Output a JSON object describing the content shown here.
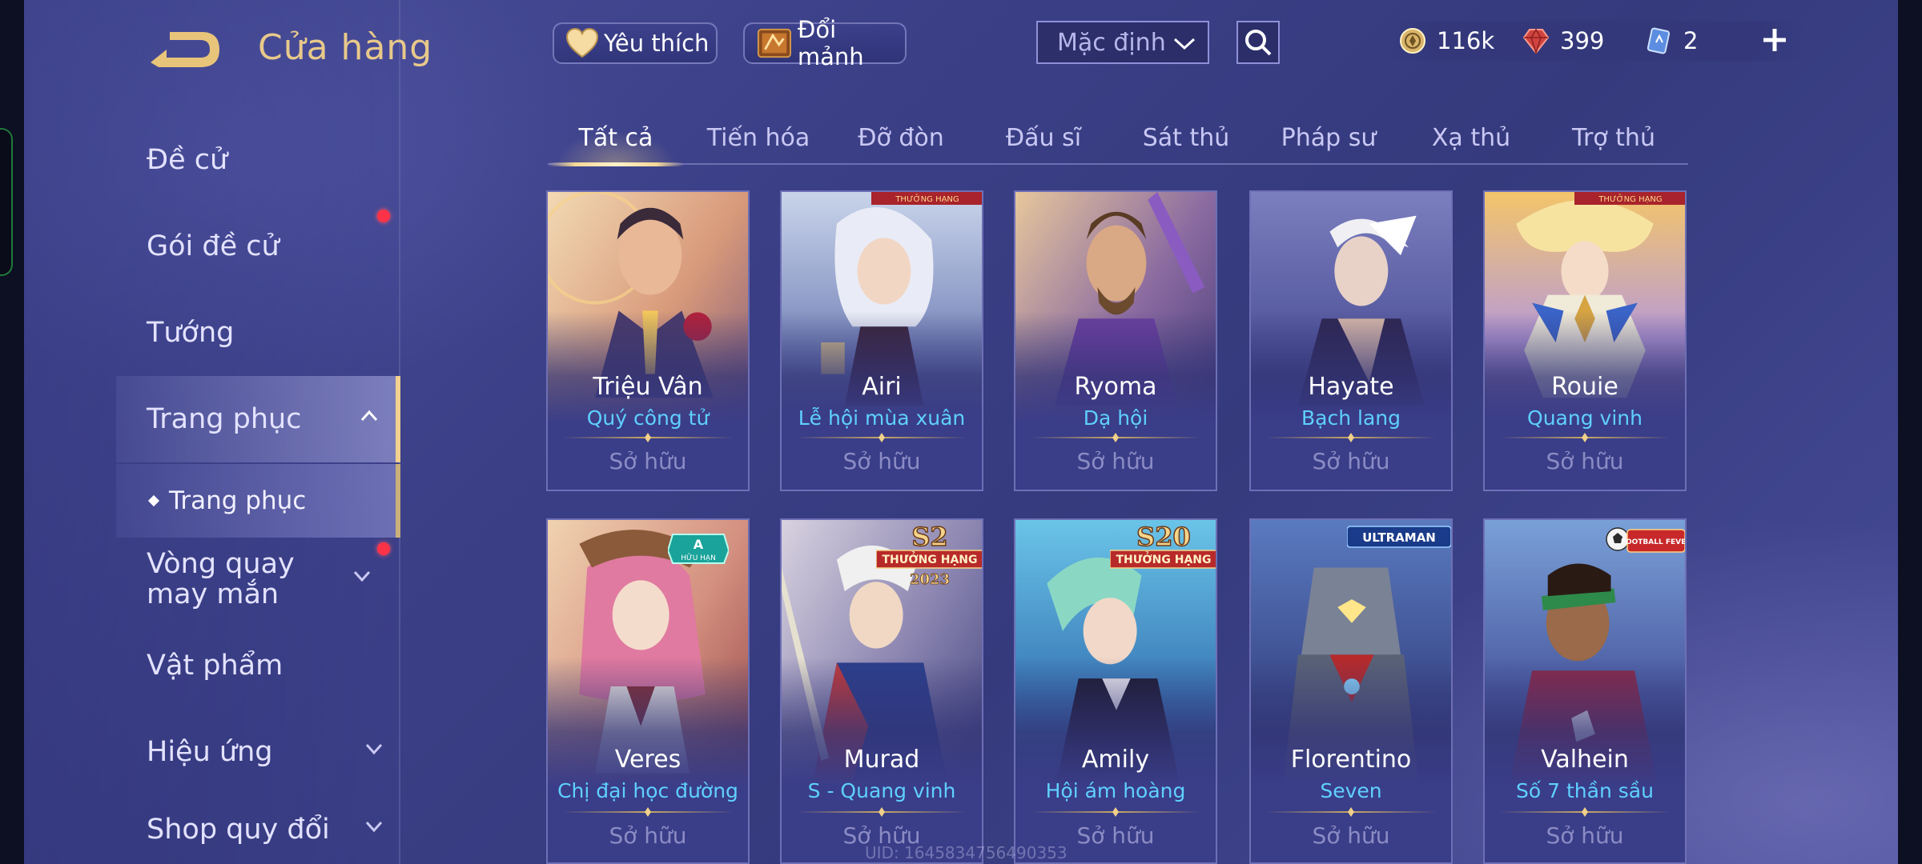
{
  "header": {
    "title": "Cửa hàng",
    "favorites_label": "Yêu thích",
    "exchange_label": "Đổi mảnh",
    "sort_value": "Mặc định"
  },
  "currency": {
    "gold": "116k",
    "gems": "399",
    "vouchers": "2"
  },
  "sidebar": {
    "items": [
      {
        "label": "Đề cử"
      },
      {
        "label": "Gói đề cử"
      },
      {
        "label": "Tướng"
      },
      {
        "label": "Trang phục"
      },
      {
        "label": "Trang phục"
      },
      {
        "label": "Vòng quay may mắn"
      },
      {
        "label": "Vật phẩm"
      },
      {
        "label": "Hiệu ứng"
      },
      {
        "label": "Shop quy đổi"
      }
    ]
  },
  "tabs": [
    {
      "label": "Tất cả"
    },
    {
      "label": "Tiến hóa"
    },
    {
      "label": "Đỡ đòn"
    },
    {
      "label": "Đấu sĩ"
    },
    {
      "label": "Sát thủ"
    },
    {
      "label": "Pháp sư"
    },
    {
      "label": "Xạ thủ"
    },
    {
      "label": "Trợ thủ"
    }
  ],
  "cards": [
    {
      "hero": "Triệu Vân",
      "skin": "Quý công tử",
      "status": "Sở hữu"
    },
    {
      "hero": "Airi",
      "skin": "Lễ hội mùa xuân",
      "status": "Sở hữu",
      "badge": "THƯỞNG HẠNG"
    },
    {
      "hero": "Ryoma",
      "skin": "Dạ hội",
      "status": "Sở hữu"
    },
    {
      "hero": "Hayate",
      "skin": "Bạch lang",
      "status": "Sở hữu"
    },
    {
      "hero": "Rouie",
      "skin": "Quang vinh",
      "status": "Sở hữu",
      "badge": "THƯỞNG HẠNG"
    },
    {
      "hero": "Veres",
      "skin": "Chị đại học đường",
      "status": "Sở hữu",
      "badge_main": "A",
      "badge_sub": "HỮU HẠN"
    },
    {
      "hero": "Murad",
      "skin": "S - Quang vinh",
      "status": "Sở hữu",
      "badge_top": "S2",
      "badge": "THƯỞNG HẠNG",
      "badge_sub": "2023"
    },
    {
      "hero": "Amily",
      "skin": "Hội ám hoàng",
      "status": "Sở hữu",
      "badge_top": "S20",
      "badge": "THƯỞNG HẠNG"
    },
    {
      "hero": "Florentino",
      "skin": "Seven",
      "status": "Sở hữu",
      "badge": "ULTRAMAN"
    },
    {
      "hero": "Valhein",
      "skin": "Số 7 thần sầu",
      "status": "Sở hữu",
      "badge": "FOOTBALL FEVER"
    }
  ],
  "footer": {
    "uid": "UID: 1645834756490353"
  },
  "colors": {
    "accent_gold": "#e8c98a",
    "skin_name": "#5fd0ff",
    "notification": "#ff3348"
  }
}
